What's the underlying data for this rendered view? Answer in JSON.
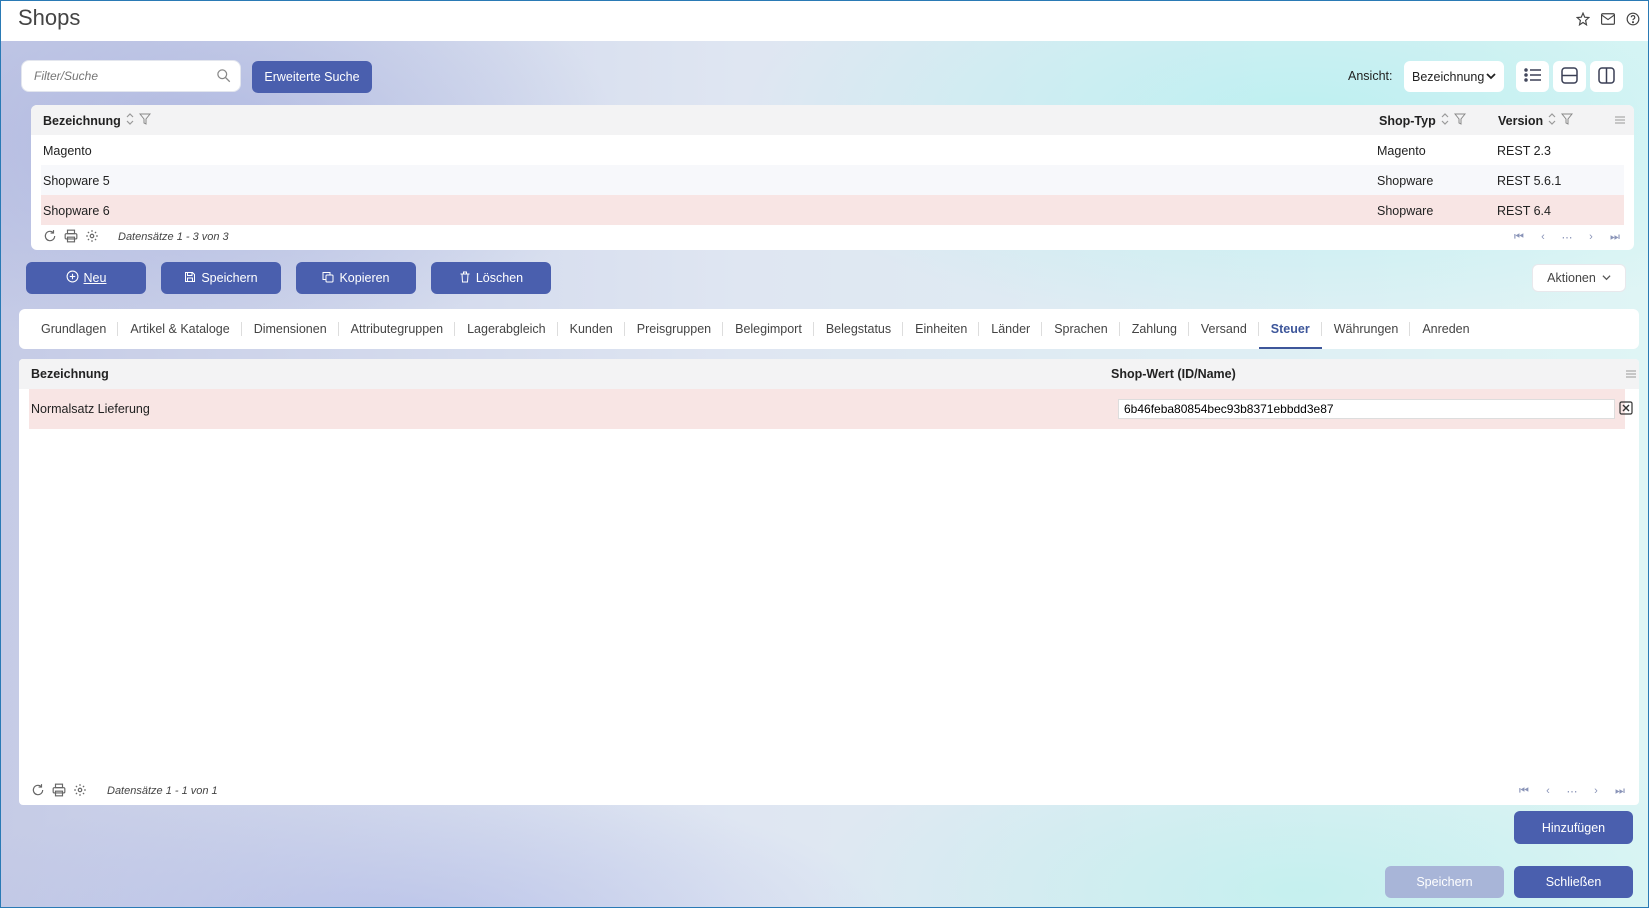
{
  "window": {
    "title": "Shops"
  },
  "search": {
    "placeholder": "Filter/Suche",
    "advanced_label": "Erweiterte Suche"
  },
  "view": {
    "label": "Ansicht:",
    "selected": "Bezeichnung"
  },
  "shops_grid": {
    "columns": {
      "name": "Bezeichnung",
      "type": "Shop-Typ",
      "version": "Version"
    },
    "rows": [
      {
        "name": "Magento",
        "type": "Magento",
        "version": "REST 2.3"
      },
      {
        "name": "Shopware 5",
        "type": "Shopware",
        "version": "REST 5.6.1"
      },
      {
        "name": "Shopware 6",
        "type": "Shopware",
        "version": "REST 6.4"
      }
    ],
    "records": "Datensätze 1 - 3 von 3"
  },
  "actions": {
    "new": "Neu",
    "save": "Speichern",
    "copy": "Kopieren",
    "delete": "Löschen",
    "more": "Aktionen"
  },
  "tabs": [
    "Grundlagen",
    "Artikel & Kataloge",
    "Dimensionen",
    "Attributegruppen",
    "Lagerabgleich",
    "Kunden",
    "Preisgruppen",
    "Belegimport",
    "Belegstatus",
    "Einheiten",
    "Länder",
    "Sprachen",
    "Zahlung",
    "Versand",
    "Steuer",
    "Währungen",
    "Anreden"
  ],
  "active_tab": "Steuer",
  "tax_grid": {
    "columns": {
      "name": "Bezeichnung",
      "value": "Shop-Wert (ID/Name)"
    },
    "rows": [
      {
        "name": "Normalsatz Lieferung",
        "value": "6b46feba80854bec93b8371ebbdd3e87"
      }
    ],
    "records": "Datensätze 1 - 1 von 1"
  },
  "footer": {
    "add": "Hinzufügen",
    "save": "Speichern",
    "close": "Schließen"
  },
  "colors": {
    "primary": "#4a5fae",
    "selected_row": "#f8e5e4",
    "active_tab": "#3d569a"
  }
}
